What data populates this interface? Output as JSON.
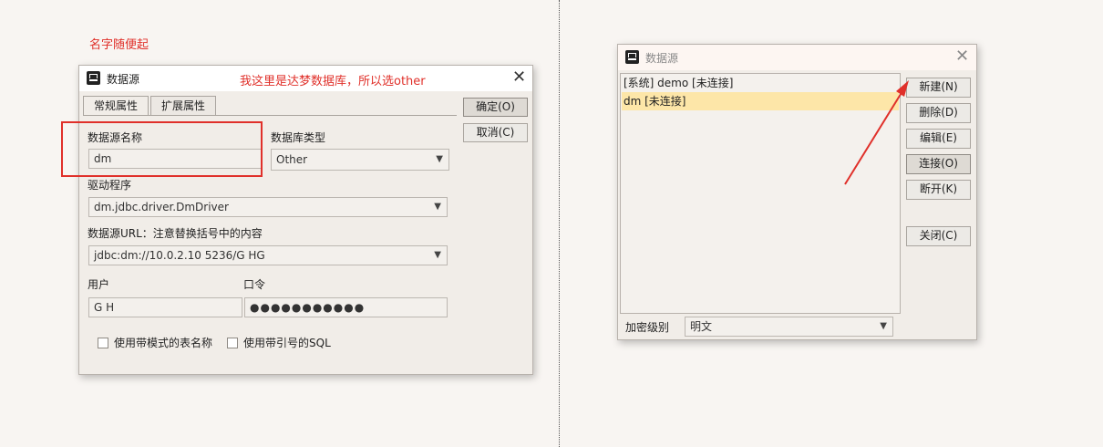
{
  "annotations": {
    "top_note": "名字随便起",
    "window_note": "我这里是达梦数据库，所以选other"
  },
  "dialog1": {
    "title": "数据源",
    "tabs": [
      "常规属性",
      "扩展属性"
    ],
    "ok_label": "确定(O)",
    "cancel_label": "取消(C)",
    "name_label": "数据源名称",
    "name_value": "dm",
    "dbtype_label": "数据库类型",
    "dbtype_value": "Other",
    "driver_label": "驱动程序",
    "driver_value": "dm.jdbc.driver.DmDriver",
    "url_label": "数据源URL：注意替换括号中的内容",
    "url_value": "jdbc:dm://10.0.2.10 5236/G HG",
    "user_label": "用户",
    "user_value": "G H",
    "password_label": "口令",
    "password_value": "●●●●●●●●●●●",
    "checkbox1_label": "使用带模式的表名称",
    "checkbox2_label": "使用带引号的SQL"
  },
  "dialog2": {
    "title": "数据源",
    "list_items": [
      "[系统] demo [未连接]",
      "dm [未连接]"
    ],
    "selected_index": 1,
    "buttons": [
      "新建(N)",
      "删除(D)",
      "编辑(E)",
      "连接(O)",
      "断开(K)"
    ],
    "close_label": "关闭(C)",
    "encrypt_label": "加密级别",
    "encrypt_value": "明文"
  },
  "colors": {
    "annotation": "#e0302a",
    "selection": "#fde6a8"
  }
}
